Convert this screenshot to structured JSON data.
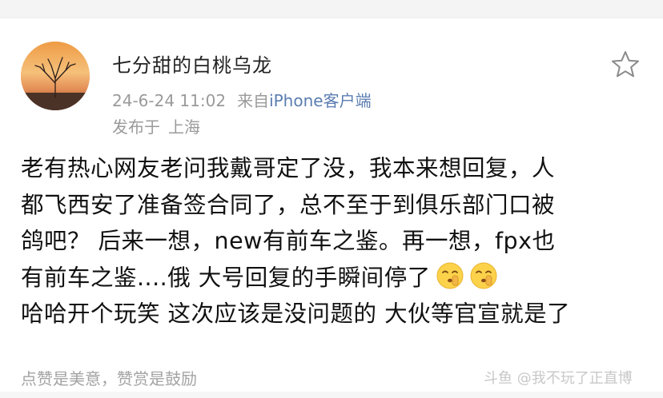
{
  "post": {
    "author": "七分甜的白桃乌龙",
    "timestamp": "24-6-24 11:02",
    "source_prefix": "来自",
    "source": "iPhone客户端",
    "location_prefix": "发布于",
    "location": "上海",
    "body_lines": [
      "老有热心网友老问我戴哥定了没，我本来想回复，人",
      "都飞西安了准备签合同了，总不至于到俱乐部门口被",
      "鸽吧？ 后来一想，new有前车之鉴。再一想，fpx也",
      "有前车之鉴....俄 大号回复的手瞬间停了",
      "哈哈开个玩笑 这次应该是没问题的 大伙等官宣就是了"
    ],
    "emojis": [
      "shush-face-emoji",
      "shush-face-emoji"
    ],
    "footer": "点赞是美意，赞赏是鼓励"
  },
  "watermark": "斗鱼 @我不玩了正直博",
  "icons": {
    "favorite": "star-outline-icon"
  },
  "colors": {
    "source_link": "#5b7db1",
    "meta_text": "#9a9a9a",
    "body_text": "#111111"
  }
}
